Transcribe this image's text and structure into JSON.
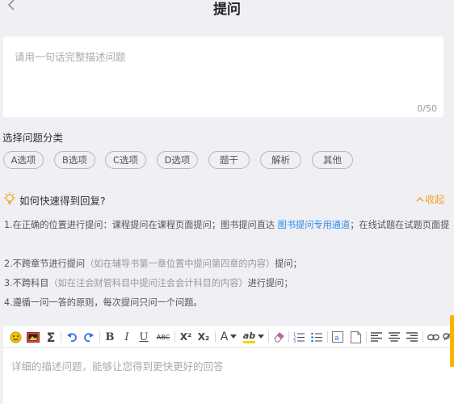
{
  "header": {
    "title": "提问"
  },
  "question": {
    "placeholder": "请用一句话完整描述问题",
    "counter": "0/50"
  },
  "category": {
    "title": "选择问题分类",
    "options": [
      "A选项",
      "B选项",
      "C选项",
      "D选项",
      "题干",
      "解析",
      "其他"
    ]
  },
  "tips": {
    "title": "如何快速得到回复?",
    "collapse_label": "收起",
    "line1_a": "1.在正确的位置进行提问：课程提问在课程页面提问；图书提问直达 ",
    "line1_link": "图书提问专用通道",
    "line1_b": "；在线试题在试题页面提",
    "line2_a": "2.不跨章节进行提问",
    "line2_muted": "（如在辅导书第一章位置中提问第四章的内容）",
    "line2_b": "提问；",
    "line3_a": "3.不跨科目",
    "line3_muted": "（如在注会财管科目中提问注会会计科目的内容）",
    "line3_b": "进行提问；",
    "line4": "4.遵循一问一答的原则，每次提问只问一个问题。"
  },
  "editor": {
    "placeholder": "详细的描述问题，能够让您得到更快更好的回答",
    "toolbar": {
      "bold": "B",
      "italic": "I",
      "underline": "U",
      "strike": "ABC",
      "superscript": "X²",
      "subscript": "X₂",
      "font_color": "A",
      "highlight": "ab"
    }
  },
  "colors": {
    "accent_orange": "#f7a11b",
    "link_blue": "#2b8ee8",
    "background": "#efeff4"
  }
}
